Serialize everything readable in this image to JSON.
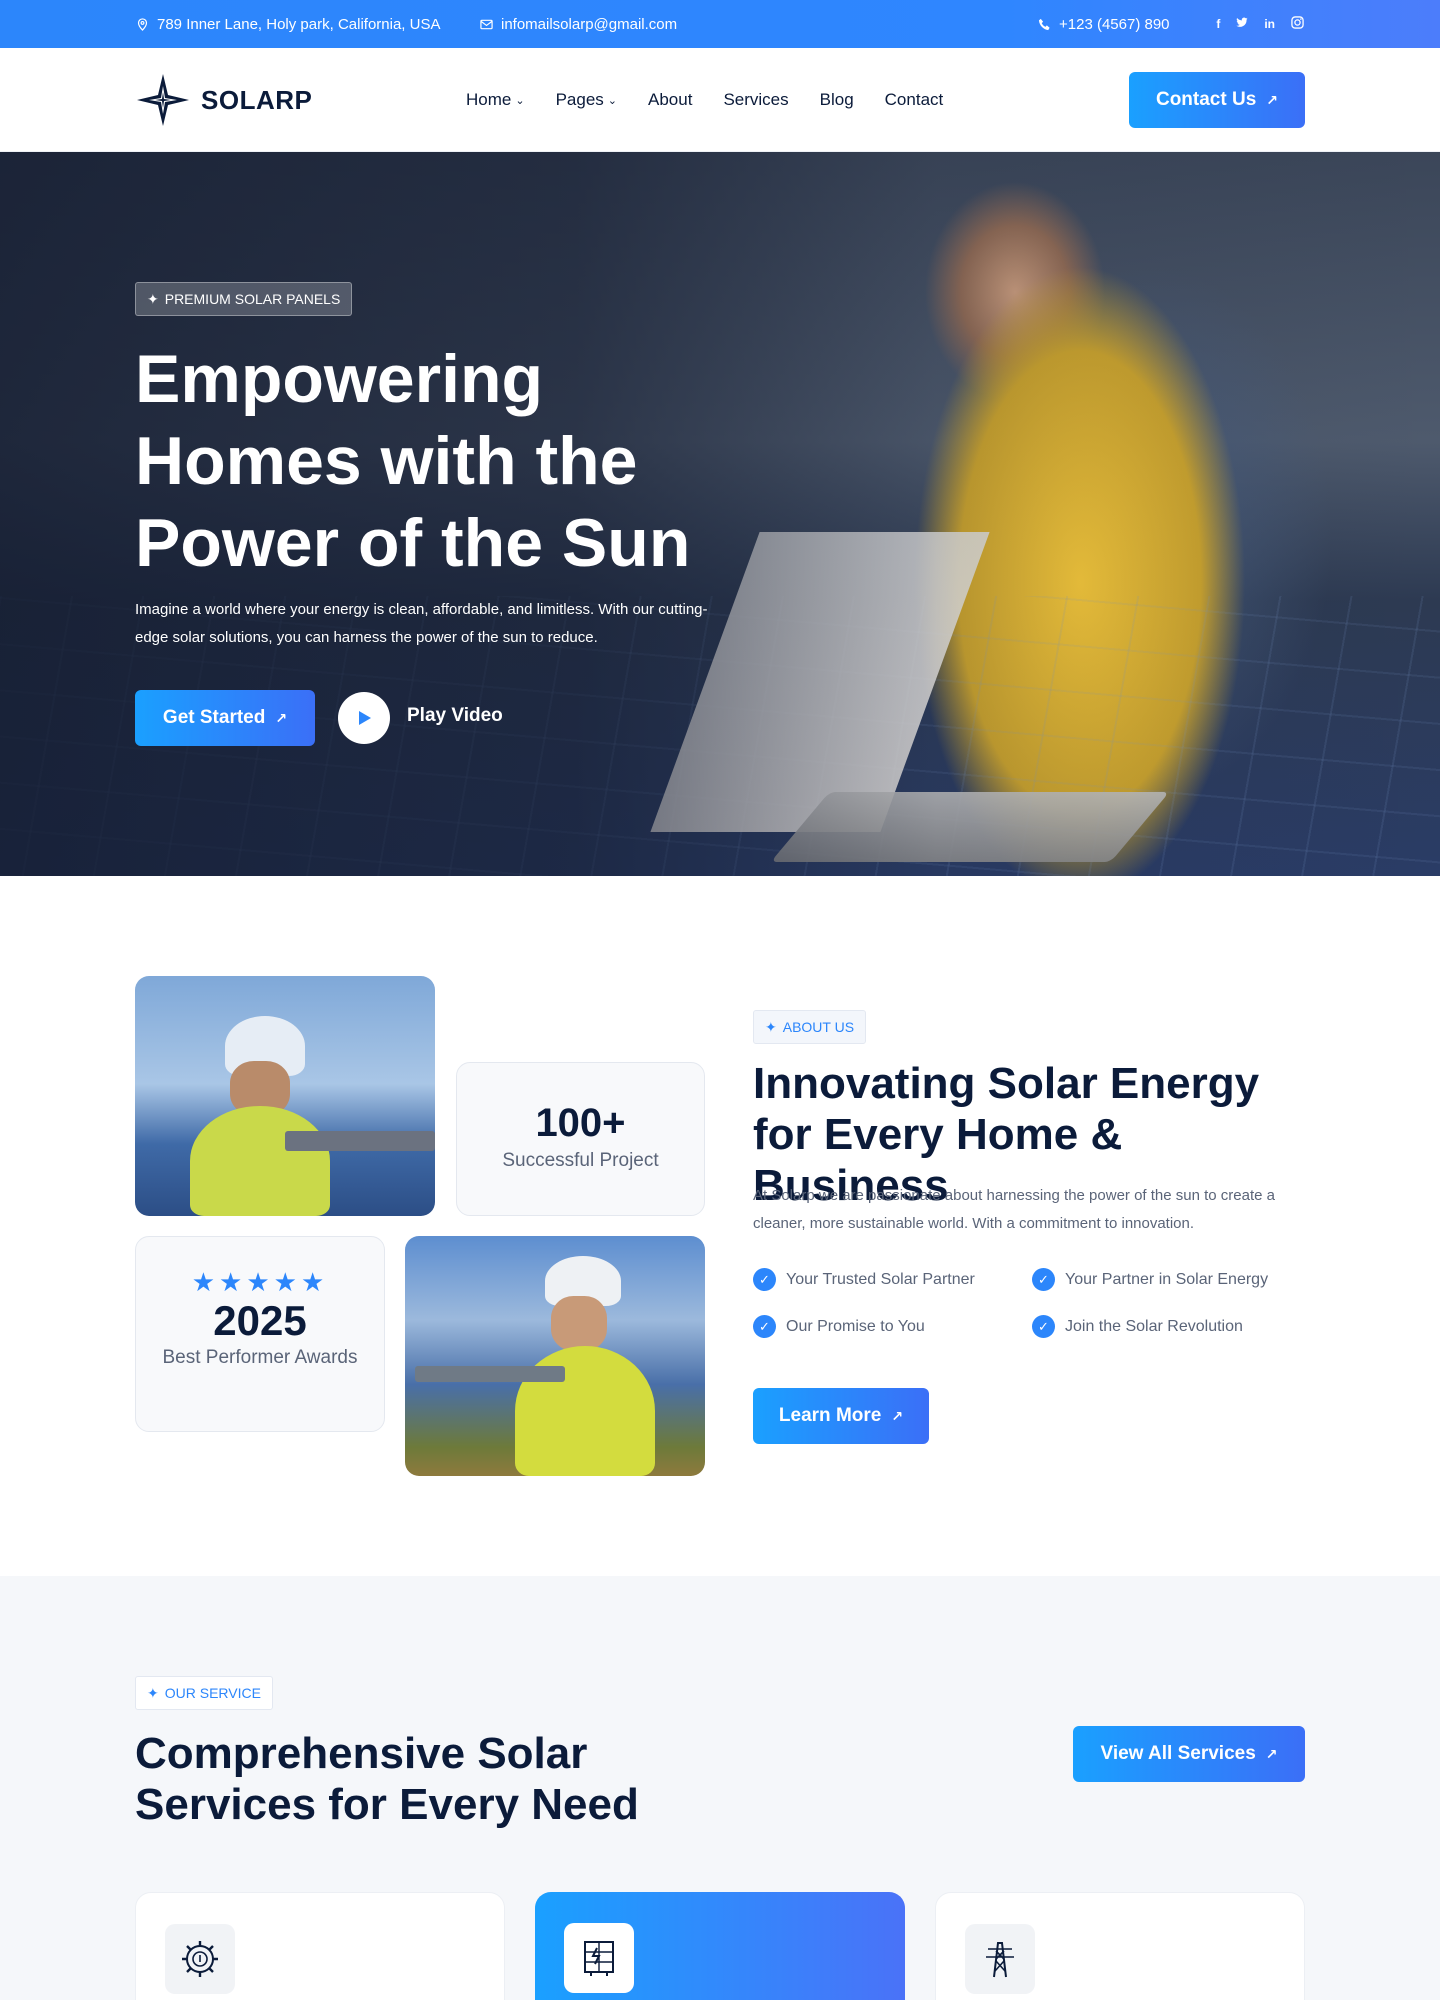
{
  "topbar": {
    "address": "789 Inner Lane, Holy park, California, USA",
    "email": "infomailsolarp@gmail.com",
    "phone": "+123 (4567) 890",
    "social": [
      "facebook-icon",
      "twitter-icon",
      "linkedin-icon",
      "instagram-icon"
    ]
  },
  "nav": {
    "logo": "SOLARP",
    "menu": [
      {
        "label": "Home",
        "dropdown": true
      },
      {
        "label": "Pages",
        "dropdown": true
      },
      {
        "label": "About",
        "dropdown": false
      },
      {
        "label": "Services",
        "dropdown": false
      },
      {
        "label": "Blog",
        "dropdown": false
      },
      {
        "label": "Contact",
        "dropdown": false
      }
    ],
    "cta": "Contact Us"
  },
  "hero": {
    "badge": "PREMIUM SOLAR PANELS",
    "title": "Empowering Homes with the Power of the Sun",
    "text": "Imagine a world where your energy is clean, affordable, and limitless. With our cutting-edge solar solutions, you can harness the power of the sun to reduce.",
    "primary": "Get Started",
    "video": "Play Video"
  },
  "about": {
    "stat1_number": "100+",
    "stat1_label": "Successful Project",
    "stars": "★★★★★",
    "rating": 5,
    "stat2_number": "2025",
    "stat2_label": "Best Performer Awards",
    "badge": "ABOUT US",
    "title": "Innovating Solar Energy for Every Home & Business",
    "text": "At Solarp we are passionate about harnessing the power of the sun to create a cleaner, more sustainable world. With a commitment to innovation.",
    "checks": [
      "Your Trusted Solar Partner",
      "Your Partner in Solar Energy",
      "Our Promise to You",
      "Join the Solar Revolution"
    ],
    "button": "Learn More"
  },
  "services": {
    "badge": "OUR SERVICE",
    "title": "Comprehensive Solar Services for Every Need",
    "button": "View All Services",
    "cards": [
      "gear-bulb-icon",
      "solar-panel-icon",
      "power-tower-icon"
    ]
  },
  "colors": {
    "accent": "#2c86fb",
    "dark": "#0b1b3a",
    "gradient_end": "#3b6ff7"
  }
}
